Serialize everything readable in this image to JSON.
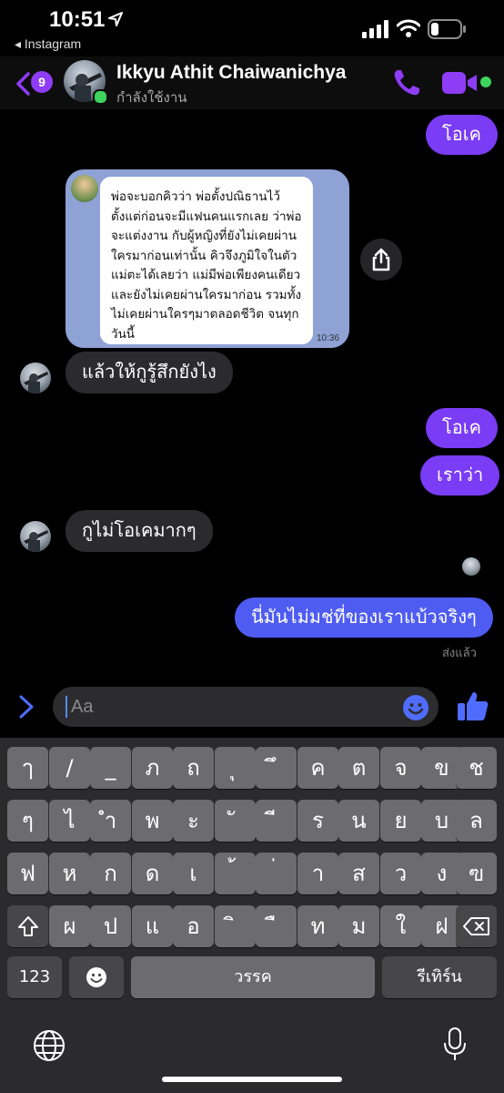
{
  "status_bar": {
    "time": "10:51",
    "back_app": "◂ Instagram"
  },
  "header": {
    "unread_count": "9",
    "contact_name": "Ikkyu Athit Chaiwanichya",
    "contact_status": "กำลังใช้งาน"
  },
  "messages": {
    "m1": "โอเค",
    "image_text": "พ่อจะบอกคิวว่า พ่อตั้งปณิธานไว้ตั้งแต่ก่อนจะมีแฟนคนแรกเลย ว่าพ่อจะแต่งงาน กับผู้หญิงที่ยังไม่เคยผ่านใครมาก่อนเท่านั้น คิวจึงภูมิใจในตัวแม่ตะได้เลยว่า แม่มีพ่อเพียงคนเดียว และยังไม่เคยผ่านใครมาก่อน รวมทั้งไม่เคยผ่านใครๆมาตลอดชีวิต จนทุกวันนี้",
    "image_time": "10:36",
    "m2": "แล้วให้กูรู้สึกยังไง",
    "m3": "โอเค",
    "m4": "เราว่า",
    "m5": "กูไม่โอเคมากๆ",
    "m6": "นี่มันไม่มช่ที่ของเราแบ้วจริงๆ",
    "sent_status": "ส่งแล้ว"
  },
  "composer": {
    "placeholder": "Aa"
  },
  "keyboard": {
    "row1": [
      "ๅ",
      "/",
      "_",
      "ภ",
      "ถ",
      "ุ",
      "ึ",
      "ค",
      "ต",
      "จ",
      "ข",
      "ช"
    ],
    "row2": [
      "ๆ",
      "ไ",
      "ำ",
      "พ",
      "ะ",
      "ั",
      "ี",
      "ร",
      "น",
      "ย",
      "บ",
      "ล"
    ],
    "row3": [
      "ฟ",
      "ห",
      "ก",
      "ด",
      "เ",
      "้",
      "่",
      "า",
      "ส",
      "ว",
      "ง",
      "ฃ"
    ],
    "row4": [
      "ผ",
      "ป",
      "แ",
      "อ",
      "ิ",
      "ื",
      "ท",
      "ม",
      "ใ",
      "ฝ"
    ],
    "numbers": "123",
    "space": "วรรค",
    "return": "รีเทิร์น"
  },
  "colors": {
    "accent": "#7a3cf5",
    "online": "#3dd35c",
    "incoming": "#2b2b2e"
  }
}
